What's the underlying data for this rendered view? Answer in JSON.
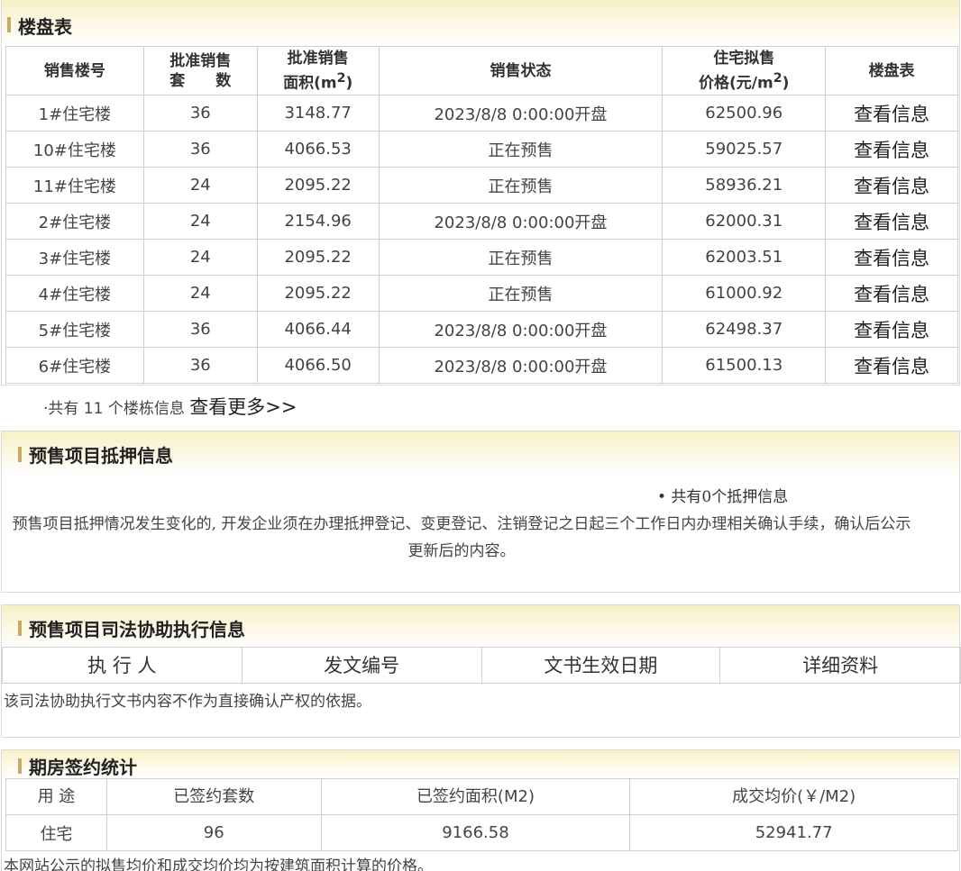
{
  "buildings_panel": {
    "title": "楼盘表",
    "headers": {
      "building": "销售楼号",
      "units_line1": "批准销售",
      "units_line2": "套　　数",
      "area_line1": "批准销售",
      "area_line2": "面积(m",
      "area_sup": "2",
      "area_end": ")",
      "status": "销售状态",
      "price_line1": "住宅拟售",
      "price_line2": "价格(元/m",
      "price_sup": "2",
      "price_end": ")",
      "table": "楼盘表"
    },
    "rows": [
      {
        "building": "1#住宅楼",
        "units": "36",
        "area": "3148.77",
        "status": "2023/8/8 0:00:00开盘",
        "price": "62500.96",
        "link": "查看信息"
      },
      {
        "building": "10#住宅楼",
        "units": "36",
        "area": "4066.53",
        "status": "正在预售",
        "price": "59025.57",
        "link": "查看信息"
      },
      {
        "building": "11#住宅楼",
        "units": "24",
        "area": "2095.22",
        "status": "正在预售",
        "price": "58936.21",
        "link": "查看信息"
      },
      {
        "building": "2#住宅楼",
        "units": "24",
        "area": "2154.96",
        "status": "2023/8/8 0:00:00开盘",
        "price": "62000.31",
        "link": "查看信息"
      },
      {
        "building": "3#住宅楼",
        "units": "24",
        "area": "2095.22",
        "status": "正在预售",
        "price": "62003.51",
        "link": "查看信息"
      },
      {
        "building": "4#住宅楼",
        "units": "24",
        "area": "2095.22",
        "status": "正在预售",
        "price": "61000.92",
        "link": "查看信息"
      },
      {
        "building": "5#住宅楼",
        "units": "36",
        "area": "4066.44",
        "status": "2023/8/8 0:00:00开盘",
        "price": "62498.37",
        "link": "查看信息"
      },
      {
        "building": "6#住宅楼",
        "units": "36",
        "area": "4066.50",
        "status": "2023/8/8 0:00:00开盘",
        "price": "61500.13",
        "link": "查看信息"
      }
    ],
    "summary_text": "·共有 11 个楼栋信息 ",
    "more_link": "查看更多>>"
  },
  "mortgage_panel": {
    "title": "预售项目抵押信息",
    "count_text": "• 共有0个抵押信息",
    "notice": "预售项目抵押情况发生变化的, 开发企业须在办理抵押登记、变更登记、注销登记之日起三个工作日内办理相关确认手续，确认后公示更新后的内容。"
  },
  "judicial_panel": {
    "title": "预售项目司法协助执行信息",
    "headers": [
      "执 行 人",
      "发文编号",
      "文书生效日期",
      "详细资料"
    ],
    "note": "该司法协助执行文书内容不作为直接确认产权的依据。"
  },
  "stats_panel": {
    "title": "期房签约统计",
    "headers": [
      "用 途",
      "已签约套数",
      "已签约面积(M2)",
      "成交均价(￥/M2)"
    ],
    "rows": [
      {
        "usage": "住宅",
        "count": "96",
        "area": "9166.58",
        "avg_price": "52941.77"
      }
    ],
    "note": "本网站公示的拟售均价和成交均价均为按建筑面积计算的价格。"
  }
}
